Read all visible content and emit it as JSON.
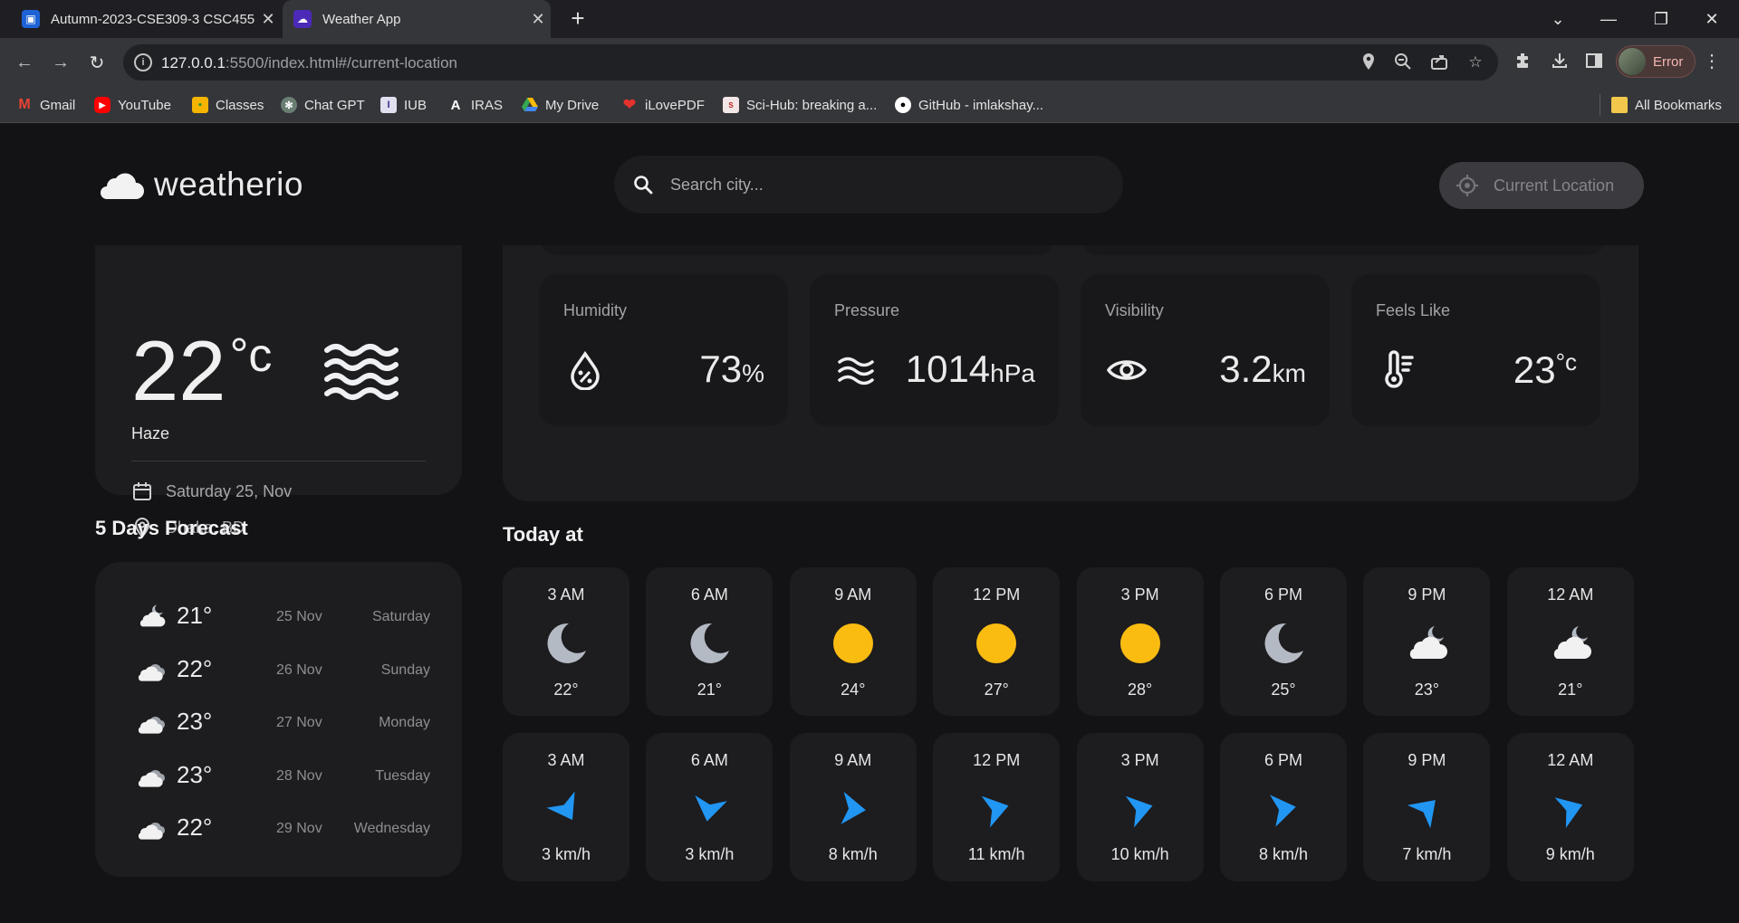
{
  "browser": {
    "tabs": [
      {
        "title": "Autumn-2023-CSE309-3 CSC455",
        "active": false
      },
      {
        "title": "Weather App",
        "active": true
      }
    ],
    "url_host": "127.0.0.1",
    "url_rest": ":5500/index.html#/current-location",
    "profile_label": "Error",
    "bookmarks": [
      {
        "label": "Gmail",
        "icon": "gmail-icon",
        "color": "#ea4335"
      },
      {
        "label": "YouTube",
        "icon": "youtube-icon",
        "color": "#ff0000"
      },
      {
        "label": "Classes",
        "icon": "classroom-icon",
        "color": "#f4b400"
      },
      {
        "label": "Chat GPT",
        "icon": "chatgpt-icon",
        "color": "#6b7e74"
      },
      {
        "label": "IUB",
        "icon": "iub-icon",
        "color": "#e0e0f0"
      },
      {
        "label": "IRAS",
        "icon": "iras-icon",
        "color": "#222222"
      },
      {
        "label": "My Drive",
        "icon": "drive-icon",
        "color": "#34a853"
      },
      {
        "label": "iLovePDF",
        "icon": "ilovepdf-icon",
        "color": "#e5322d"
      },
      {
        "label": "Sci-Hub: breaking a...",
        "icon": "scihub-icon",
        "color": "#b71c1c"
      },
      {
        "label": "GitHub - imlakshay...",
        "icon": "github-icon",
        "color": "#ffffff"
      }
    ],
    "all_bookmarks": "All Bookmarks"
  },
  "header": {
    "app_name": "weatherio",
    "search_placeholder": "Search city...",
    "current_location_label": "Current Location"
  },
  "current": {
    "temp": "22",
    "unit": "°c",
    "description": "Haze",
    "date": "Saturday 25, Nov",
    "location": "Dhaka, BD"
  },
  "highlights": [
    {
      "title": "Humidity",
      "value": "73",
      "unit": "%",
      "icon": "humidity-icon"
    },
    {
      "title": "Pressure",
      "value": "1014",
      "unit": "hPa",
      "icon": "waves-icon"
    },
    {
      "title": "Visibility",
      "value": "3.2",
      "unit": "km",
      "icon": "eye-icon"
    },
    {
      "title": "Feels Like",
      "value": "23",
      "unit": "°c",
      "icon": "thermometer-icon"
    }
  ],
  "forecast": {
    "title": "5 Days Forecast",
    "days": [
      {
        "temp": "21°",
        "date": "25 Nov",
        "weekday": "Saturday",
        "icon": "cloud-night-icon"
      },
      {
        "temp": "22°",
        "date": "26 Nov",
        "weekday": "Sunday",
        "icon": "cloudy-icon"
      },
      {
        "temp": "23°",
        "date": "27 Nov",
        "weekday": "Monday",
        "icon": "cloudy-icon"
      },
      {
        "temp": "23°",
        "date": "28 Nov",
        "weekday": "Tuesday",
        "icon": "cloudy-icon"
      },
      {
        "temp": "22°",
        "date": "29 Nov",
        "weekday": "Wednesday",
        "icon": "cloudy-icon"
      }
    ]
  },
  "today": {
    "title": "Today at",
    "hours": [
      {
        "time": "3 AM",
        "temp": "22°",
        "icon": "moon-icon"
      },
      {
        "time": "6 AM",
        "temp": "21°",
        "icon": "moon-icon"
      },
      {
        "time": "9 AM",
        "temp": "24°",
        "icon": "sun-icon"
      },
      {
        "time": "12 PM",
        "temp": "27°",
        "icon": "sun-icon"
      },
      {
        "time": "3 PM",
        "temp": "28°",
        "icon": "sun-icon"
      },
      {
        "time": "6 PM",
        "temp": "25°",
        "icon": "moon-icon"
      },
      {
        "time": "9 PM",
        "temp": "23°",
        "icon": "cloud-night-icon"
      },
      {
        "time": "12 AM",
        "temp": "21°",
        "icon": "cloud-night-icon"
      }
    ],
    "wind": [
      {
        "time": "3 AM",
        "speed": "3 km/h",
        "direction_deg": 60
      },
      {
        "time": "6 AM",
        "speed": "3 km/h",
        "direction_deg": 100
      },
      {
        "time": "9 AM",
        "speed": "8 km/h",
        "direction_deg": 5
      },
      {
        "time": "12 PM",
        "speed": "11 km/h",
        "direction_deg": -15
      },
      {
        "time": "3 PM",
        "speed": "10 km/h",
        "direction_deg": -15
      },
      {
        "time": "6 PM",
        "speed": "8 km/h",
        "direction_deg": -10
      },
      {
        "time": "9 PM",
        "speed": "7 km/h",
        "direction_deg": -45
      },
      {
        "time": "12 AM",
        "speed": "9 km/h",
        "direction_deg": -20
      }
    ]
  },
  "colors": {
    "sun": "#fbbc12",
    "moon": "#b4bac3",
    "wind": "#2196f3",
    "cloud": "#f1f1f1"
  }
}
